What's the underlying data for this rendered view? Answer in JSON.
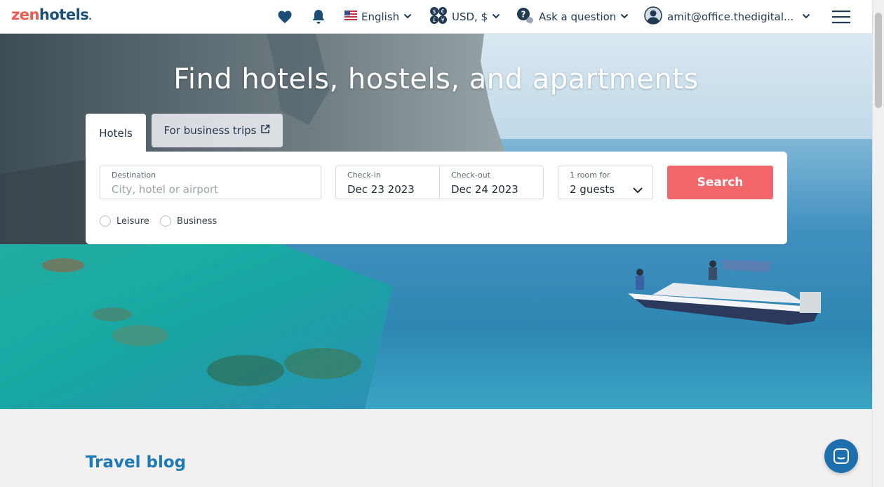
{
  "header": {
    "logo_part1": "zen",
    "logo_part2": "hotels",
    "language": "English",
    "currency": "USD, $",
    "help": "Ask a question",
    "account": "amit@office.thedigital..."
  },
  "hero": {
    "title": "Find hotels, hostels, and apartments"
  },
  "tabs": {
    "hotels": "Hotels",
    "business": "For business trips"
  },
  "search": {
    "destination_label": "Destination",
    "destination_placeholder": "City, hotel or airport",
    "checkin_label": "Check-in",
    "checkin_value": "Dec 23 2023",
    "checkout_label": "Check-out",
    "checkout_value": "Dec 24 2023",
    "guests_label": "1 room for",
    "guests_value": "2 guests",
    "button": "Search"
  },
  "trip_type": {
    "leisure": "Leisure",
    "business": "Business"
  },
  "sections": {
    "blog_title": "Travel blog"
  },
  "colors": {
    "brand_red": "#ef5a4e",
    "brand_blue": "#1b4f78",
    "search_button": "#f2676a",
    "link_blue": "#1d7ab8",
    "chat_button": "#1d6fae"
  },
  "icons": {
    "favorites": "heart-icon",
    "notifications": "bell-icon",
    "language_flag": "us-flag-icon",
    "currency": "currency-icon",
    "help": "question-chat-icon",
    "avatar": "user-avatar-icon",
    "menu": "hamburger-menu-icon",
    "external": "external-link-icon",
    "chat": "chat-icon"
  }
}
